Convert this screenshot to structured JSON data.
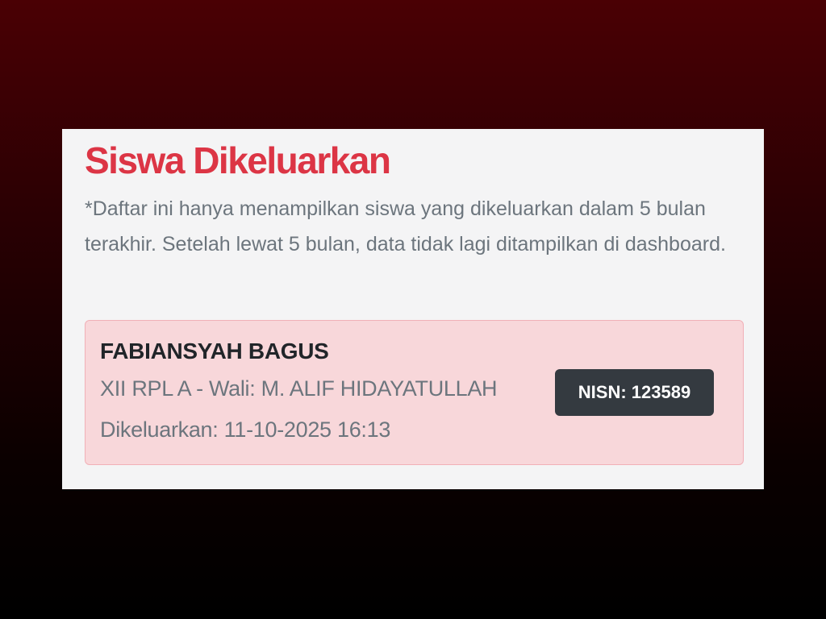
{
  "section": {
    "title": "Siswa Dikeluarkan",
    "note": "*Daftar ini hanya menampilkan siswa yang dikeluarkan dalam 5 bulan terakhir. Setelah lewat 5 bulan, data tidak lagi ditampilkan di dashboard."
  },
  "students": [
    {
      "name": "FABIANSYAH BAGUS",
      "class_info": "XII RPL A - Wali: M. ALIF HIDAYATULLAH",
      "expelled_at": "Dikeluarkan: 11-10-2025 16:13",
      "nisn_badge": "NISN: 123589"
    }
  ],
  "colors": {
    "title": "#dc3545",
    "card_background": "#f8d7da",
    "card_border": "#f1b0b7",
    "badge_background": "#343a40",
    "muted_text": "#6c757d"
  }
}
